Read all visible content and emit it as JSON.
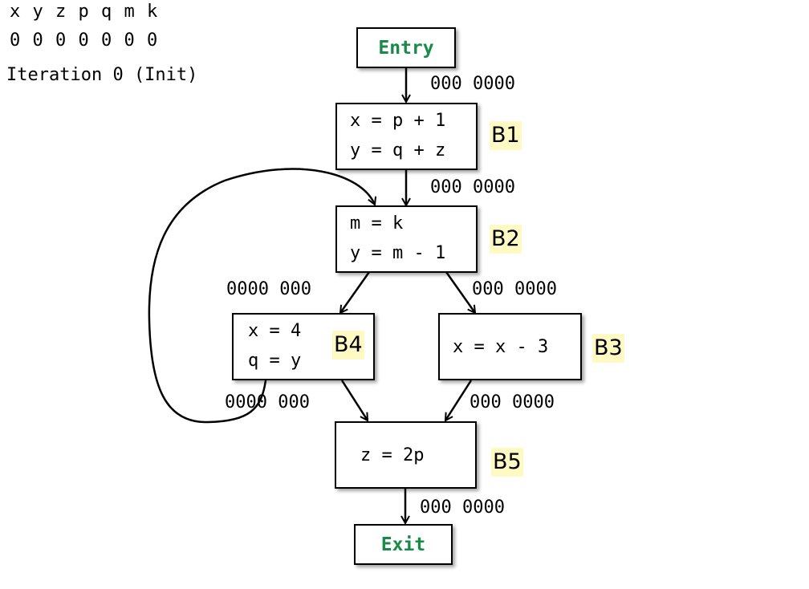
{
  "header": {
    "variables": "x y z p q m k",
    "bits": "0 0 0 0 0 0 0",
    "iteration": "Iteration 0 (Init)"
  },
  "nodes": {
    "entry": {
      "label": "Entry"
    },
    "exit": {
      "label": "Exit"
    },
    "b1": {
      "name": "B1",
      "stmts": [
        "x = p + 1",
        "y = q + z"
      ]
    },
    "b2": {
      "name": "B2",
      "stmts": [
        "m = k",
        "y = m - 1"
      ]
    },
    "b3": {
      "name": "B3",
      "stmts": [
        "x = x - 3"
      ]
    },
    "b4": {
      "name": "B4",
      "stmts": [
        "x = 4",
        "q = y"
      ]
    },
    "b5": {
      "name": "B5",
      "stmts": [
        "z = 2p"
      ]
    }
  },
  "edges": {
    "entry_b1": "000 0000",
    "b1_b2": "000 0000",
    "b2_b4": "0000 000",
    "b2_b3": "000 0000",
    "b4_out": "0000 000",
    "b3_b5": "000 0000",
    "b5_exit": "000 0000"
  },
  "colors": {
    "terminal_text": "#1a8a4a",
    "block_label_bg": "#fff9c4"
  }
}
